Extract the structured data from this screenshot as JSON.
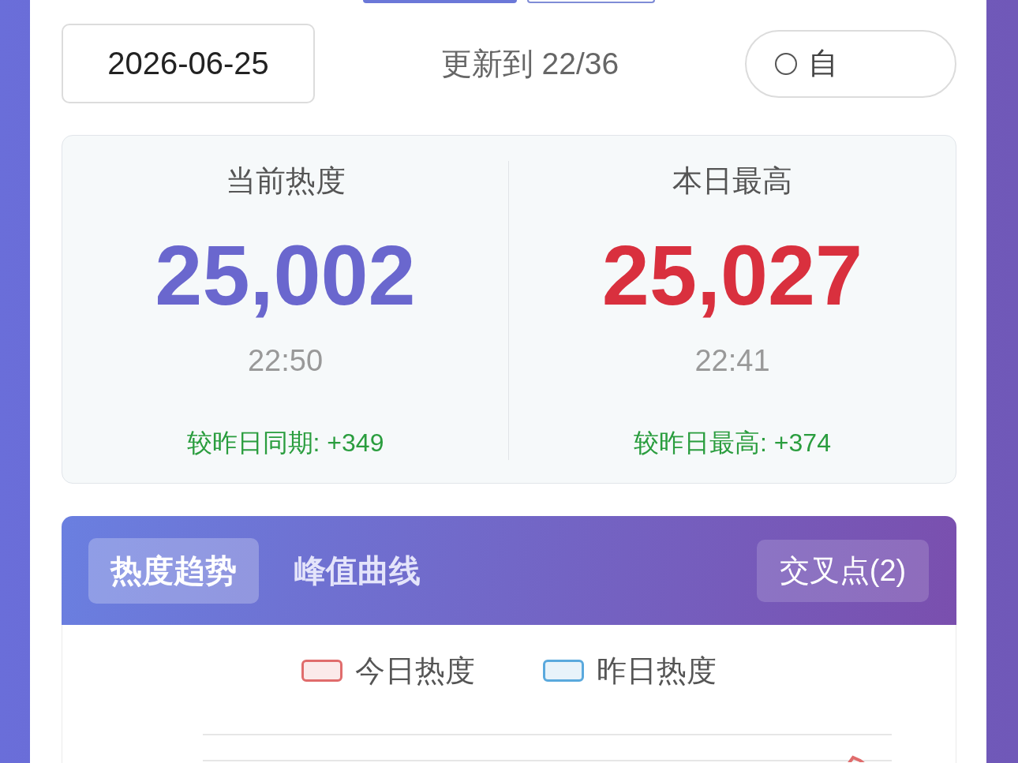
{
  "view_toggle": [
    {
      "selected": true
    },
    {
      "selected": false
    }
  ],
  "toolbar": {
    "date": "2026-06-25",
    "update_status": "更新到 22/36",
    "auto_refresh": {
      "label": "自",
      "checked": false
    }
  },
  "stats": [
    {
      "title": "当前热度",
      "value": "25,002",
      "color": "#6a67ce",
      "time": "22:50",
      "change": "较昨日同期: +349"
    },
    {
      "title": "本日最高",
      "value": "25,027",
      "color": "#d9303e",
      "time": "22:41",
      "change": "较昨日最高: +374"
    }
  ],
  "chart_panel": {
    "tabs": [
      {
        "label": "热度趋势",
        "selected": true
      },
      {
        "label": "峰值曲线",
        "selected": false
      }
    ],
    "cross_points_button": "交叉点(2)",
    "legend": [
      {
        "label": "今日热度",
        "color": "#e06c6c"
      },
      {
        "label": "昨日热度",
        "color": "#5aa9dd"
      }
    ]
  }
}
